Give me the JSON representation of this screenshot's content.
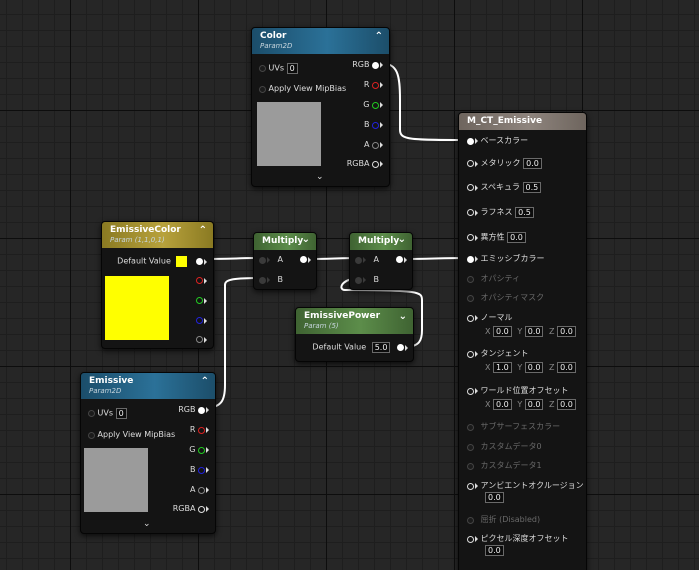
{
  "nodes": {
    "color": {
      "title": "Color",
      "subtitle": "Param2D",
      "uvs_label": "UVs",
      "uvs_value": "0",
      "mip_label": "Apply View MipBias",
      "outputs": [
        "RGB",
        "R",
        "G",
        "B",
        "A",
        "RGBA"
      ]
    },
    "emissive_color": {
      "title": "EmissiveColor",
      "subtitle": "Param (1,1,0,1)",
      "default_label": "Default Value",
      "swatch_color": "#ffff00"
    },
    "multiply1": {
      "title": "Multiply",
      "a": "A",
      "b": "B"
    },
    "multiply2": {
      "title": "Multiply",
      "a": "A",
      "b": "B"
    },
    "emissive_power": {
      "title": "EmissivePower",
      "subtitle": "Param (5)",
      "default_label": "Default Value",
      "default_value": "5.0"
    },
    "emissive": {
      "title": "Emissive",
      "subtitle": "Param2D",
      "uvs_label": "UVs",
      "uvs_value": "0",
      "mip_label": "Apply View MipBias",
      "outputs": [
        "RGB",
        "R",
        "G",
        "B",
        "A",
        "RGBA"
      ]
    },
    "material": {
      "title": "M_CT_Emissive",
      "base_color": "ベースカラー",
      "metallic": "メタリック",
      "metallic_value": "0.0",
      "specular": "スペキュラ",
      "specular_value": "0.5",
      "roughness": "ラフネス",
      "roughness_value": "0.5",
      "anisotropy": "異方性",
      "anisotropy_value": "0.0",
      "emissive_color": "エミッシブカラー",
      "opacity": "オパシティ",
      "opacity_mask": "オパシティマスク",
      "normal": "ノーマル",
      "normal_x": "0.0",
      "normal_y": "0.0",
      "normal_z": "0.0",
      "tangent": "タンジェント",
      "tangent_x": "1.0",
      "tangent_y": "0.0",
      "tangent_z": "0.0",
      "wpo": "ワールド位置オフセット",
      "wpo_x": "0.0",
      "wpo_y": "0.0",
      "wpo_z": "0.0",
      "subsurface": "サブサーフェスカラー",
      "custom0": "カスタムデータ0",
      "custom1": "カスタムデータ1",
      "ao": "アンビエントオクルージョン",
      "ao_value": "0.0",
      "refraction": "屈折 (Disabled)",
      "pdo": "ピクセル深度オフセット",
      "pdo_value": "0.0",
      "x_label": "X",
      "y_label": "Y",
      "z_label": "Z"
    }
  },
  "colors": {
    "wire": "#ffffff",
    "grid_bg": "#262626",
    "texture_preview": "#9b9b9b"
  },
  "icons": {
    "collapse": "chevron-up-icon",
    "expand": "chevron-down-icon"
  }
}
